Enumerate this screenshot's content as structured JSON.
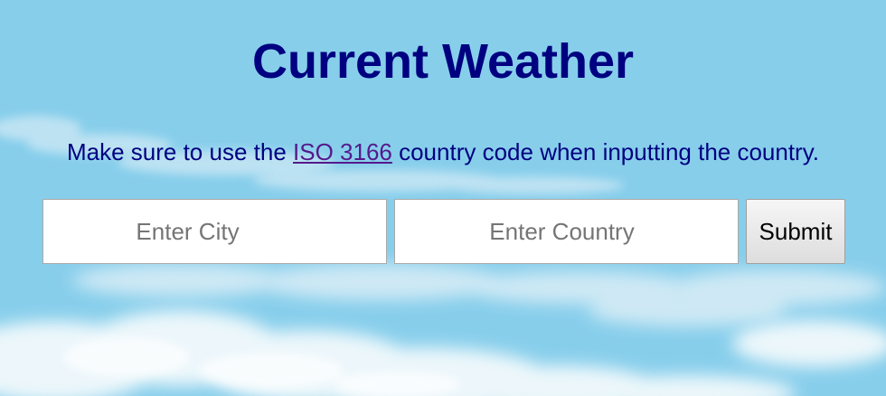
{
  "page": {
    "title": "Current Weather",
    "note": {
      "before": "Make sure to use the ",
      "link_text": "ISO 3166",
      "after": " country code when inputting the country."
    }
  },
  "form": {
    "city_placeholder": "Enter City",
    "city_value": "",
    "country_placeholder": "Enter Country",
    "country_value": "",
    "submit_label": "Submit"
  },
  "colors": {
    "sky": "#87ceeb",
    "heading": "#000080",
    "link_visited": "#551a8b"
  }
}
